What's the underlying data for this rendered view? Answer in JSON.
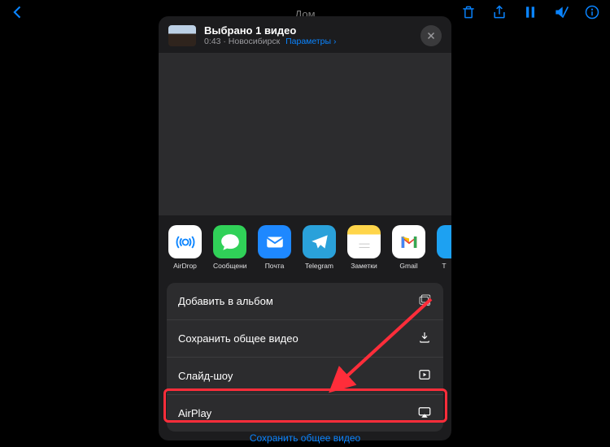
{
  "nav": {
    "title": "Дом"
  },
  "sheet": {
    "title": "Выбрано 1 видео",
    "subtitle": "0:43 · Новосибирск",
    "params_label": "Параметры"
  },
  "share_apps": [
    {
      "name": "AirDrop",
      "label": "AirDrop"
    },
    {
      "name": "Сообщения",
      "label": "Сообщения"
    },
    {
      "name": "Почта",
      "label": "Почта"
    },
    {
      "name": "Telegram",
      "label": "Telegram"
    },
    {
      "name": "Заметки",
      "label": "Заметки"
    },
    {
      "name": "Gmail",
      "label": "Gmail"
    },
    {
      "name": "T",
      "label": "T"
    }
  ],
  "actions": {
    "add_to_album": "Добавить в альбом",
    "save_shared": "Сохранить общее видео",
    "slideshow": "Слайд-шоу",
    "airplay": "AirPlay"
  },
  "footer": {
    "save_shared_video": "Сохранить общее видео"
  },
  "colors": {
    "accent": "#0a84ff",
    "highlight": "#ff2d3a",
    "sheet_bg": "#1c1c1e",
    "group_bg": "#2c2c2e"
  }
}
